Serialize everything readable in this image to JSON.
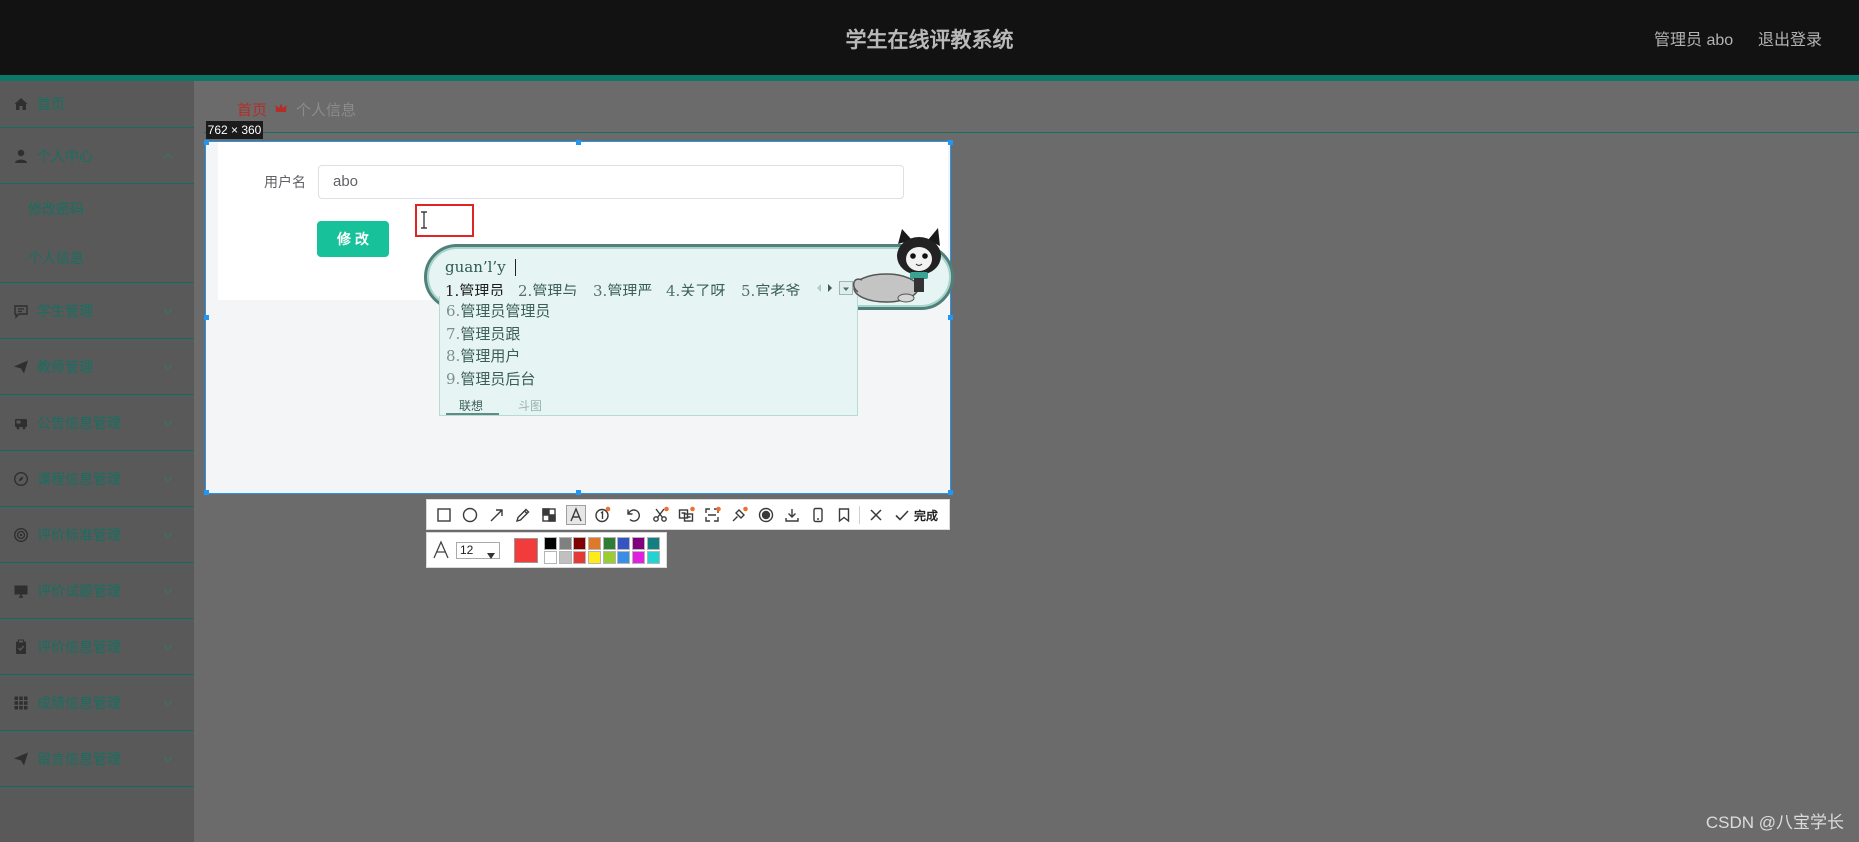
{
  "header": {
    "title": "学生在线评教系统",
    "user_label": "管理员 abo",
    "logout_label": "退出登录"
  },
  "sidebar": {
    "items": [
      {
        "label": "首页",
        "icon": "home-icon"
      },
      {
        "label": "个人中心",
        "icon": "user-icon",
        "expanded": true,
        "children": [
          {
            "label": "修改密码"
          },
          {
            "label": "个人信息"
          }
        ]
      },
      {
        "label": "学生管理",
        "icon": "message-icon"
      },
      {
        "label": "教师管理",
        "icon": "paper-plane-icon"
      },
      {
        "label": "公告信息管理",
        "icon": "bus-icon"
      },
      {
        "label": "课程信息管理",
        "icon": "compass-icon"
      },
      {
        "label": "评价标准管理",
        "icon": "target-icon"
      },
      {
        "label": "评价试题管理",
        "icon": "monitor-icon"
      },
      {
        "label": "评价信息管理",
        "icon": "clipboard-icon"
      },
      {
        "label": "成绩信息管理",
        "icon": "grid-icon"
      },
      {
        "label": "留言信息管理",
        "icon": "paper-plane-icon"
      }
    ]
  },
  "breadcrumb": {
    "home": "首页",
    "current": "个人信息"
  },
  "form": {
    "username_label": "用户名",
    "username_value": "abo",
    "submit_label": "修 改"
  },
  "capture": {
    "size_label": "762 × 360",
    "tools": [
      "rectangle-icon",
      "ellipse-icon",
      "arrow-icon",
      "pen-icon",
      "mosaic-icon",
      "text-icon",
      "number-icon",
      "undo-icon",
      "cut-icon",
      "ocr-icon",
      "scan-icon",
      "pin-icon",
      "record-icon",
      "download-icon",
      "phone-icon",
      "bookmark-icon",
      "close-icon",
      "confirm-icon"
    ],
    "done_label": "完成",
    "font_size": "12",
    "current_color": "#f23c3c",
    "palette": [
      "#000000",
      "#808080",
      "#800000",
      "#e0782a",
      "#2e7d32",
      "#3553c4",
      "#800080",
      "#128080",
      "#ffffff",
      "#c0c0c0",
      "#e53935",
      "#ffeb1a",
      "#9acd32",
      "#3a8ee6",
      "#e020e0",
      "#22d3d3"
    ]
  },
  "ime": {
    "composition": "guan’l’y",
    "candidates": [
      {
        "num": "1.",
        "text": "管理员"
      },
      {
        "num": "2.",
        "text": "管理与"
      },
      {
        "num": "3.",
        "text": "管理严"
      },
      {
        "num": "4.",
        "text": "关了呀"
      },
      {
        "num": "5.",
        "text": "官老爷"
      }
    ],
    "more": [
      {
        "num": "6.",
        "text": "管理员管理员"
      },
      {
        "num": "7.",
        "text": "管理员跟"
      },
      {
        "num": "8.",
        "text": "管理用户"
      },
      {
        "num": "9.",
        "text": "管理员后台"
      }
    ],
    "tabs": [
      "联想",
      "斗图"
    ]
  },
  "theme": {
    "accent": "#17c19a",
    "header_bg": "#121212",
    "stripe": "#0d7768",
    "selection_border": "#2196f3"
  },
  "watermark": "CSDN @八宝学长"
}
